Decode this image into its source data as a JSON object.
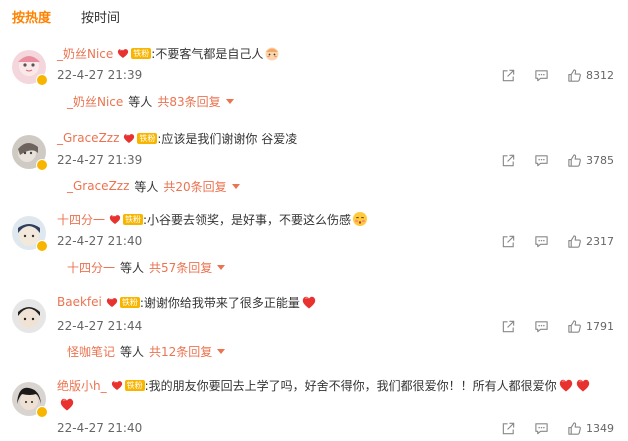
{
  "sort_tabs": [
    {
      "label": "按热度"
    },
    {
      "label": "按时间"
    }
  ],
  "fan_badge_text": "铁粉",
  "colors": {
    "accent": "#ff8200",
    "username": "#eb7350",
    "fan_badge": "#f7b500",
    "heart": "#e8322f"
  },
  "comments": [
    {
      "username": "_奶丝Nice",
      "text": ":不要客气都是自己人",
      "emoji": "cute-face-emoji",
      "time": "22-4-27 21:39",
      "likes": "8312",
      "reply_user": "_奶丝Nice",
      "reply_etc": "等人",
      "reply_count": "共83条回复"
    },
    {
      "username": "_GraceZzz",
      "text": ":应该是我们谢谢你 谷爱凌",
      "time": "22-4-27 21:39",
      "likes": "3785",
      "reply_user": "_GraceZzz",
      "reply_etc": "等人",
      "reply_count": "共20条回复"
    },
    {
      "username": "十四分一",
      "text": ":小谷要去领奖，是好事，不要这么伤感",
      "emoji": "blushing-face-emoji",
      "time": "22-4-27 21:40",
      "likes": "2317",
      "reply_user": "十四分一",
      "reply_etc": "等人",
      "reply_count": "共57条回复"
    },
    {
      "username": "Baekfei",
      "text": ":谢谢你给我带来了很多正能量",
      "emoji": "heart-emoji",
      "time": "22-4-27 21:44",
      "likes": "1791",
      "reply_user": "怪咖笔记",
      "reply_etc": "等人",
      "reply_count": "共12条回复"
    },
    {
      "username": "绝版小h_",
      "text": ":我的朋友你要回去上学了吗，好舍不得你，我们都很爱你！！所有人都很爱你",
      "emoji": "heart-emoji",
      "time": "22-4-27 21:40",
      "likes": "1349"
    }
  ]
}
